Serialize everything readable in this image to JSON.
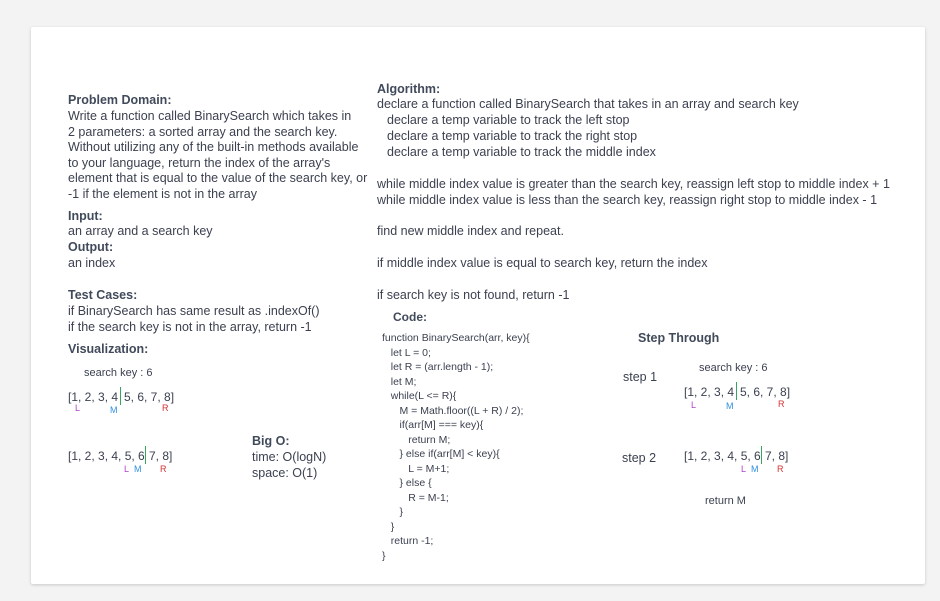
{
  "problem": {
    "heading": "Problem Domain:",
    "lines": [
      "Write a function called BinarySearch which takes in",
      "2 parameters: a sorted array and the search key.",
      "Without utilizing any of the built-in methods available",
      "to your language, return the index of the array's",
      "element that is equal to the value of the search key, or",
      "-1 if the element is not in the array"
    ]
  },
  "input": {
    "heading": "Input:",
    "text": "an array and a search key"
  },
  "output": {
    "heading": "Output:",
    "text": "an index"
  },
  "tests": {
    "heading": "Test Cases:",
    "lines": [
      "if BinarySearch has same result as .indexOf()",
      "if the search key is not in the array, return -1"
    ]
  },
  "visualization": {
    "heading": "Visualization:",
    "search_key": "search key : 6",
    "array_1_left": "[1, 2, 3, 4",
    "array_1_right": "5, 6, 7, 8]",
    "array_2_left": "[1, 2, 3, 4, 5, 6",
    "array_2_right": "7, 8]",
    "marker_l": "L",
    "marker_m": "M",
    "marker_r": "R"
  },
  "bigo": {
    "heading": "Big O:",
    "time": "time: O(logN)",
    "space": "space: O(1)"
  },
  "algorithm": {
    "heading": "Algorithm:",
    "lines": [
      "declare a function called BinarySearch that takes in an array and search key",
      "declare a temp variable to track the left stop",
      "declare a temp variable to track the right stop",
      "declare a temp variable to track the middle index"
    ],
    "while_lines": [
      "while middle index value is greater than the search key, reassign left stop to middle index + 1",
      "while middle index value is less than the search key, reassign right stop to middle index - 1"
    ],
    "find": "find new middle index and repeat.",
    "equal": "if middle index value is equal to search key, return the index",
    "notfound": "if search key is not found, return -1"
  },
  "code": {
    "heading": "Code:",
    "lines": [
      "function BinarySearch(arr, key){",
      "   let L = 0;",
      "   let R = (arr.length - 1);",
      "   let M;",
      "   while(L <= R){",
      "      M = Math.floor((L + R) / 2);",
      "      if(arr[M] === key){",
      "         return M;",
      "      } else if(arr[M] < key){",
      "         L = M+1;",
      "      } else {",
      "         R = M-1;",
      "      }",
      "   }",
      "   return -1;",
      "}"
    ]
  },
  "step_through": {
    "heading": "Step Through",
    "search_key": "search key : 6",
    "step1_label": "step 1",
    "step2_label": "step 2",
    "array_1_left": "[1, 2, 3, 4",
    "array_1_right": "5, 6, 7, 8]",
    "array_2_left": "[1, 2, 3, 4, 5, 6",
    "array_2_right": "7, 8]",
    "marker_l": "L",
    "marker_m": "M",
    "marker_r": "R",
    "result": "return M"
  },
  "colors": {
    "left": "#b040d0",
    "middle": "#2f8fe0",
    "right": "#d33030",
    "divider": "#3aa35f"
  }
}
